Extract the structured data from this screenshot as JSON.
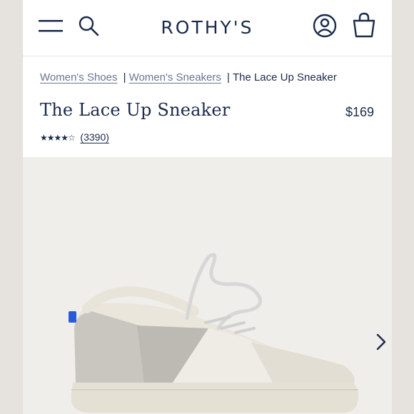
{
  "header": {
    "logo": "ROTHY'S",
    "icons": [
      "menu-icon",
      "search-icon",
      "account-icon",
      "cart-icon"
    ]
  },
  "breadcrumb": {
    "items": [
      "Women's Shoes",
      "Women's Sneakers"
    ],
    "separator": "|",
    "current": "The Lace Up Sneaker"
  },
  "product": {
    "title": "The Lace Up Sneaker",
    "price": "$169",
    "rating_stars": "★★★★☆",
    "rating_value": 4.5,
    "review_count": "(3390)"
  },
  "gallery": {
    "next_icon": "chevron-right-icon"
  },
  "colors": {
    "navy": "#1b2a4a",
    "accent_blue": "#2a5bd7",
    "background": "#f0eeeb"
  }
}
